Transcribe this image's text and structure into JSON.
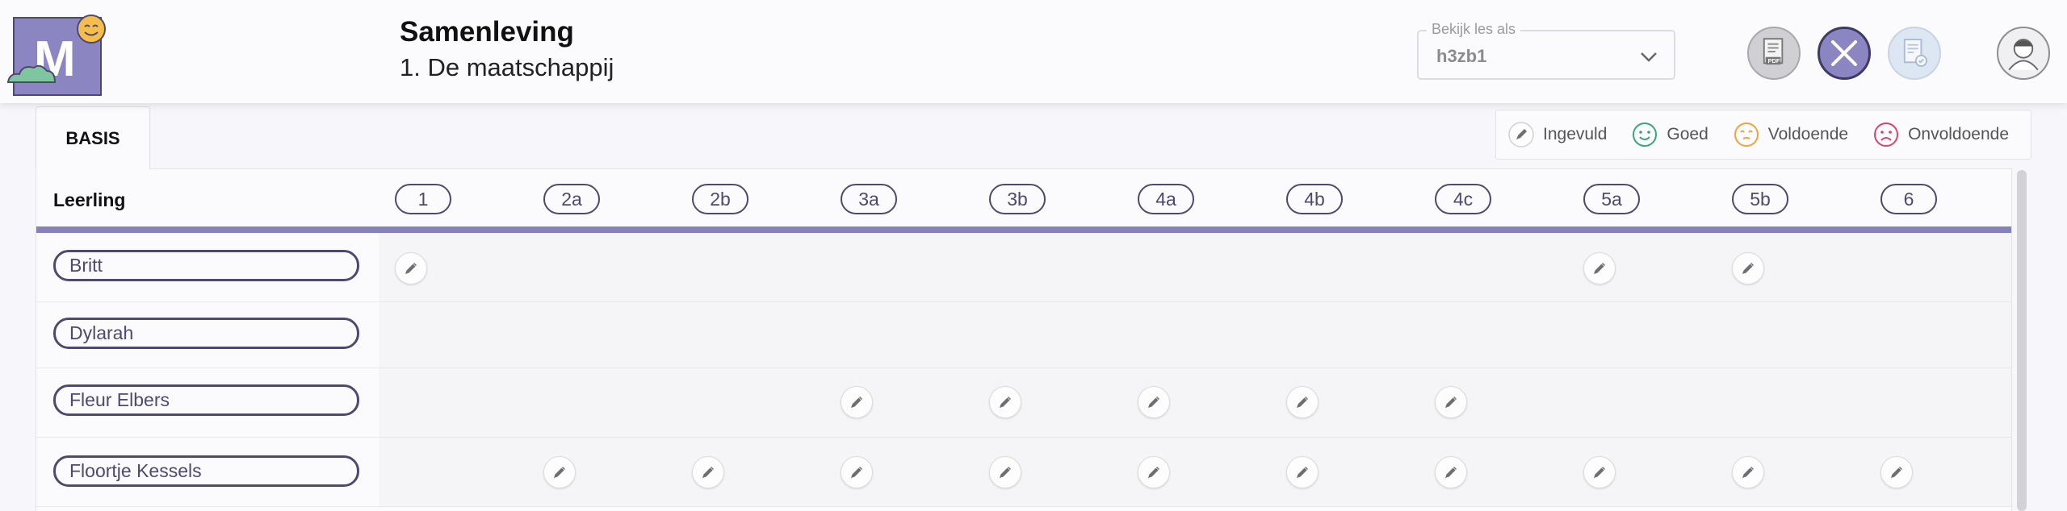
{
  "header": {
    "title": "Samenleving",
    "subtitle": "1. De maatschappij",
    "logo_letter": "M",
    "view_as": {
      "legend": "Bekijk les als",
      "value": "h3zb1"
    }
  },
  "tabs": [
    {
      "label": "BASIS"
    }
  ],
  "legend": [
    {
      "label": "Ingevuld",
      "icon": "pencil-icon",
      "color": "#6d6d72"
    },
    {
      "label": "Goed",
      "icon": "smiley-happy-icon",
      "color": "#3aa57a"
    },
    {
      "label": "Voldoende",
      "icon": "smiley-neutral-icon",
      "color": "#f0a43a"
    },
    {
      "label": "Onvoldoende",
      "icon": "smiley-sad-icon",
      "color": "#d8456b"
    }
  ],
  "table": {
    "name_header": "Leerling",
    "columns": [
      "1",
      "2a",
      "2b",
      "3a",
      "3b",
      "4a",
      "4b",
      "4c",
      "5a",
      "5b",
      "6"
    ],
    "rows": [
      {
        "name": "Britt",
        "filled": [
          "1",
          "5a",
          "5b"
        ]
      },
      {
        "name": "Dylarah",
        "filled": []
      },
      {
        "name": "Fleur Elbers",
        "filled": [
          "3a",
          "3b",
          "4a",
          "4b",
          "4c"
        ]
      },
      {
        "name": "Floortje Kessels",
        "filled": [
          "2a",
          "2b",
          "3a",
          "3b",
          "4a",
          "4b",
          "4c",
          "5a",
          "5b",
          "6"
        ]
      }
    ]
  },
  "colors": {
    "accent": "#8581bb",
    "outline": "#4d4a6e",
    "logo_bg": "#8b86c2"
  }
}
